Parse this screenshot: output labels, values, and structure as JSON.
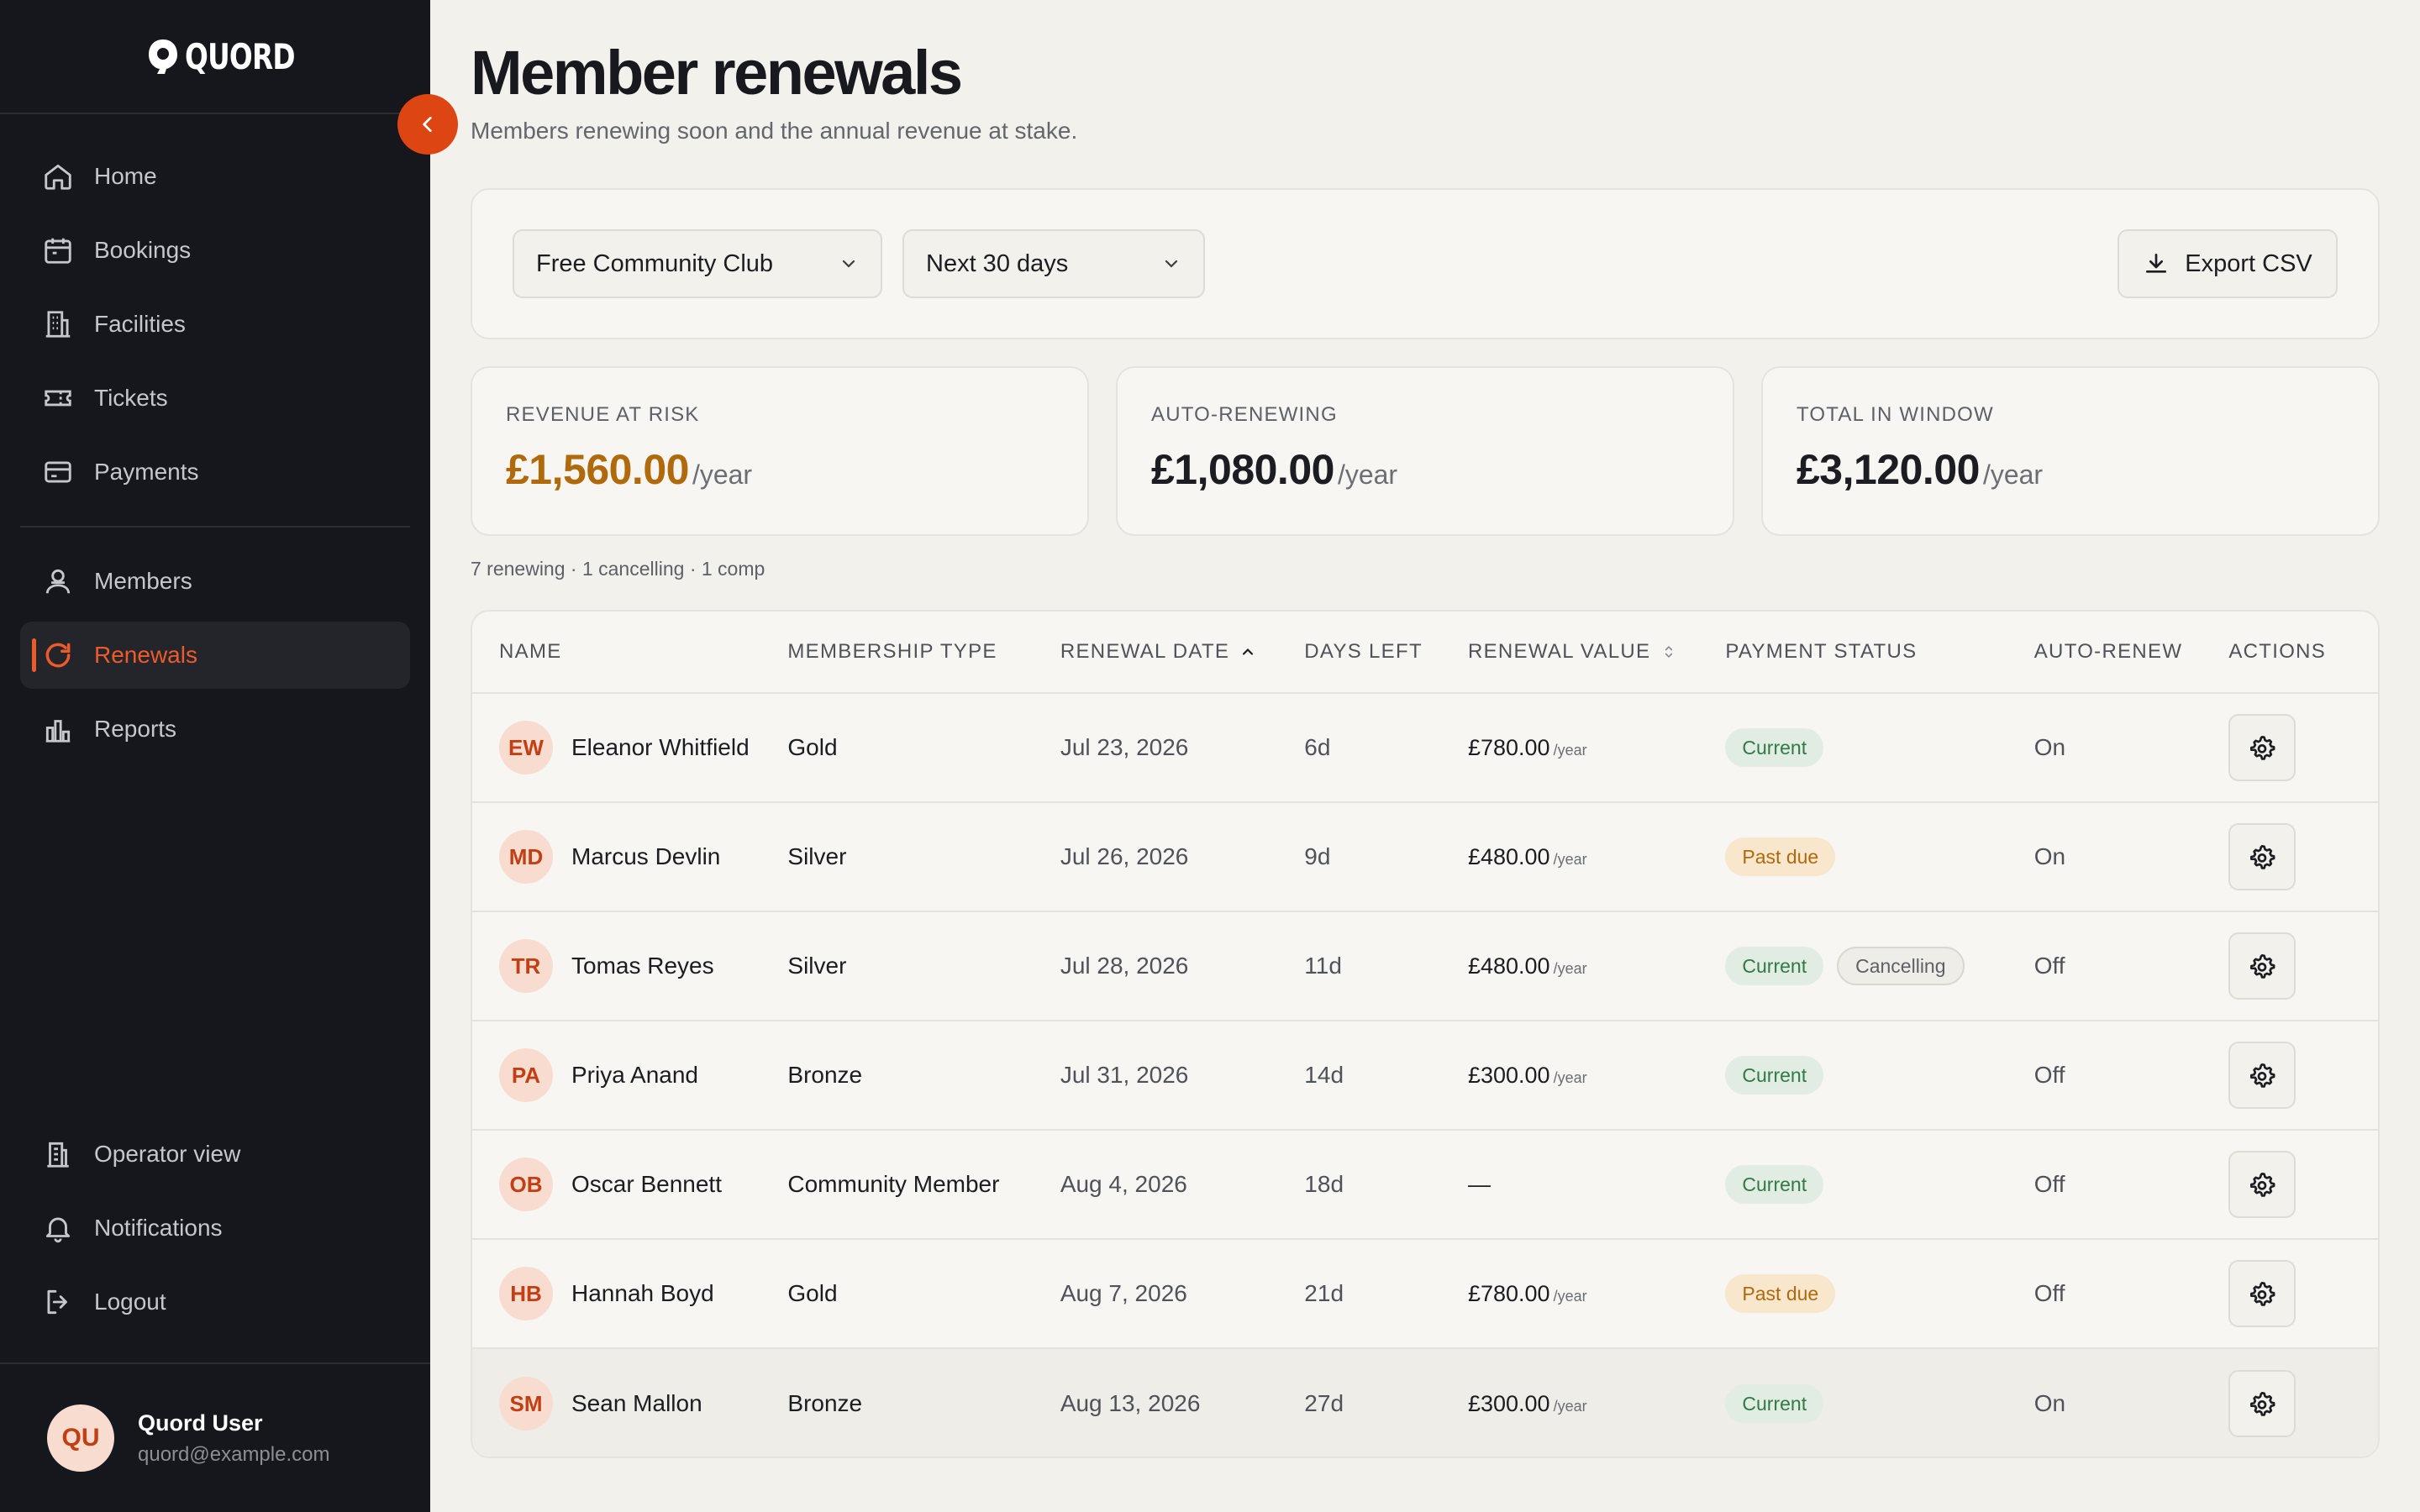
{
  "app": {
    "brand": "QUORD"
  },
  "colors": {
    "accent": "#ee5b2a",
    "sidebar_bg": "#15171c",
    "warning": "#b06a0b",
    "success": "#2f7a45"
  },
  "sidebar": {
    "items": [
      {
        "label": "Home",
        "icon": "home-icon"
      },
      {
        "label": "Bookings",
        "icon": "calendar-icon"
      },
      {
        "label": "Facilities",
        "icon": "building-icon"
      },
      {
        "label": "Tickets",
        "icon": "ticket-icon"
      },
      {
        "label": "Payments",
        "icon": "credit-card-icon"
      },
      {
        "label": "Members",
        "icon": "users-icon"
      },
      {
        "label": "Renewals",
        "icon": "refresh-icon",
        "active": true
      },
      {
        "label": "Reports",
        "icon": "bar-chart-icon"
      }
    ],
    "footer_items": [
      {
        "label": "Operator view",
        "icon": "building-icon"
      },
      {
        "label": "Notifications",
        "icon": "bell-icon"
      },
      {
        "label": "Logout",
        "icon": "logout-icon"
      }
    ],
    "user": {
      "initials": "QU",
      "name": "Quord User",
      "email": "quord@example.com"
    }
  },
  "header": {
    "title": "Member renewals",
    "subtitle": "Members renewing soon and the annual revenue at stake."
  },
  "filters": {
    "club": "Free Community Club",
    "window": "Next 30 days",
    "export_label": "Export CSV"
  },
  "stats": [
    {
      "label": "REVENUE AT RISK",
      "value": "£1,560.00",
      "suffix": "/year",
      "tone": "warn"
    },
    {
      "label": "AUTO-RENEWING",
      "value": "£1,080.00",
      "suffix": "/year"
    },
    {
      "label": "TOTAL IN WINDOW",
      "value": "£3,120.00",
      "suffix": "/year"
    }
  ],
  "summary": "7 renewing · 1 cancelling · 1 comp",
  "table": {
    "columns": [
      "NAME",
      "MEMBERSHIP TYPE",
      "RENEWAL DATE",
      "DAYS LEFT",
      "RENEWAL VALUE",
      "PAYMENT STATUS",
      "AUTO-RENEW",
      "ACTIONS"
    ],
    "sort": {
      "column": "RENEWAL DATE",
      "direction": "asc"
    },
    "rows": [
      {
        "initials": "EW",
        "name": "Eleanor Whitfield",
        "type": "Gold",
        "date": "Jul 23, 2026",
        "days": "6d",
        "value": "£780.00",
        "per": "/year",
        "status": [
          "Current"
        ],
        "auto": "On"
      },
      {
        "initials": "MD",
        "name": "Marcus Devlin",
        "type": "Silver",
        "date": "Jul 26, 2026",
        "days": "9d",
        "value": "£480.00",
        "per": "/year",
        "status": [
          "Past due"
        ],
        "auto": "On"
      },
      {
        "initials": "TR",
        "name": "Tomas Reyes",
        "type": "Silver",
        "date": "Jul 28, 2026",
        "days": "11d",
        "value": "£480.00",
        "per": "/year",
        "status": [
          "Current",
          "Cancelling"
        ],
        "auto": "Off"
      },
      {
        "initials": "PA",
        "name": "Priya Anand",
        "type": "Bronze",
        "date": "Jul 31, 2026",
        "days": "14d",
        "value": "£300.00",
        "per": "/year",
        "status": [
          "Current"
        ],
        "auto": "Off"
      },
      {
        "initials": "OB",
        "name": "Oscar Bennett",
        "type": "Community Member",
        "date": "Aug 4, 2026",
        "days": "18d",
        "value": "—",
        "per": "",
        "status": [
          "Current"
        ],
        "auto": "Off"
      },
      {
        "initials": "HB",
        "name": "Hannah Boyd",
        "type": "Gold",
        "date": "Aug 7, 2026",
        "days": "21d",
        "value": "£780.00",
        "per": "/year",
        "status": [
          "Past due"
        ],
        "auto": "Off"
      },
      {
        "initials": "SM",
        "name": "Sean Mallon",
        "type": "Bronze",
        "date": "Aug 13, 2026",
        "days": "27d",
        "value": "£300.00",
        "per": "/year",
        "status": [
          "Current"
        ],
        "auto": "On"
      }
    ]
  }
}
